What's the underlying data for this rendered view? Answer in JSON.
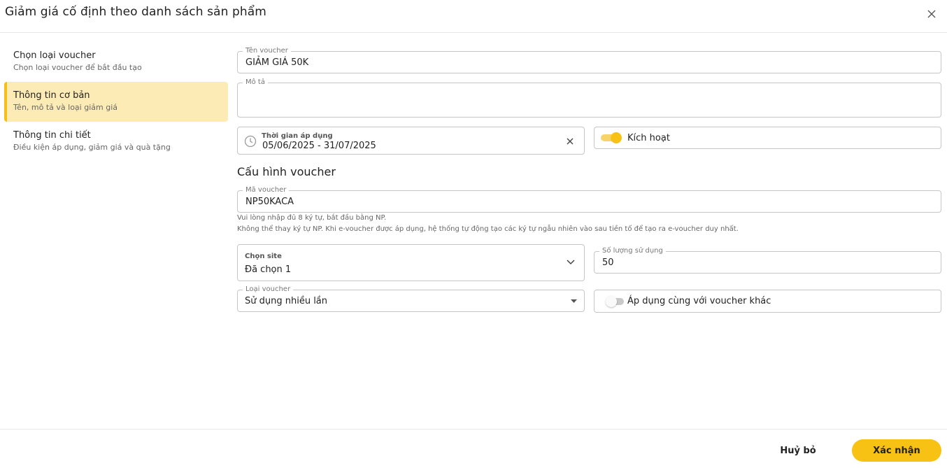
{
  "dialog": {
    "title": "Giảm giá cố định theo danh sách sản phẩm"
  },
  "stepper": {
    "steps": [
      {
        "title": "Chọn loại voucher",
        "subtitle": "Chọn loại voucher để bắt đầu tạo"
      },
      {
        "title": "Thông tin cơ bản",
        "subtitle": "Tên, mô tả và loại giảm giá"
      },
      {
        "title": "Thông tin chi tiết",
        "subtitle": "Điều kiện áp dụng, giảm giá và quà tặng"
      }
    ]
  },
  "form": {
    "voucher_name": {
      "label": "Tên voucher",
      "value": "GIẢM GIÁ 50K"
    },
    "description": {
      "label": "Mô tả",
      "value": ""
    },
    "period": {
      "label": "Thời gian áp dụng",
      "value": "05/06/2025 - 31/07/2025"
    },
    "activate": {
      "label": "Kích hoạt",
      "on": true
    },
    "config_title": "Cấu hình voucher",
    "voucher_code": {
      "label": "Mã voucher",
      "value": "NP50KACA"
    },
    "hint_line1": "Vui lòng nhập đủ 8 ký tự, bắt đầu bằng NP.",
    "hint_line2": "Không thể thay ký tự NP. Khi e-voucher được áp dụng, hệ thống tự động tạo các ký tự ngẫu nhiên vào sau tiền tố để tạo ra e-voucher duy nhất.",
    "site": {
      "label": "Chọn site",
      "value": "Đã chọn 1"
    },
    "usage_count": {
      "label": "Số lượng sử dụng",
      "value": "50"
    },
    "voucher_type": {
      "label": "Loại voucher",
      "value": "Sử dụng nhiều lần"
    },
    "combine": {
      "label": "Áp dụng cùng với voucher khác",
      "on": false
    }
  },
  "footer": {
    "cancel_label": "Huỷ bỏ",
    "confirm_label": "Xác nhận"
  },
  "colors": {
    "accent": "#f8c214",
    "active_step_bg": "#fdebb5"
  }
}
